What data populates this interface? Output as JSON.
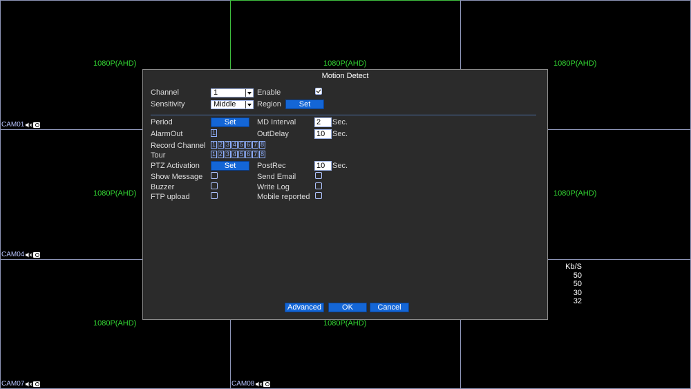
{
  "cameras": [
    {
      "id": "cam1",
      "resolution": "1080P(AHD)",
      "label": "CAM01"
    },
    {
      "id": "cam2",
      "resolution": "1080P(AHD)",
      "label": ""
    },
    {
      "id": "cam3",
      "resolution": "1080P(AHD)",
      "label": ""
    },
    {
      "id": "cam4",
      "resolution": "1080P(AHD)",
      "label": "CAM04"
    },
    {
      "id": "cam5",
      "resolution": "",
      "label": ""
    },
    {
      "id": "cam6",
      "resolution": "1080P(AHD)",
      "label": ""
    },
    {
      "id": "cam7",
      "resolution": "1080P(AHD)",
      "label": "CAM07"
    },
    {
      "id": "cam8",
      "resolution": "1080P(AHD)",
      "label": "CAM08"
    },
    {
      "id": "cam9",
      "resolution": "",
      "label": ""
    }
  ],
  "bitrate": {
    "header": "Kb/S",
    "values": [
      "50",
      "50",
      "30",
      "32"
    ]
  },
  "dialog": {
    "title": "Motion Detect",
    "channel_label": "Channel",
    "channel_value": "1",
    "enable_label": "Enable",
    "sensitivity_label": "Sensitivity",
    "sensitivity_value": "Middle",
    "region_label": "Region",
    "set_label": "Set",
    "period_label": "Period",
    "md_interval_label": "MD Interval",
    "md_interval_value": "2",
    "sec_label": "Sec.",
    "alarmout_label": "AlarmOut",
    "alarmout_value": "1",
    "outdelay_label": "OutDelay",
    "outdelay_value": "10",
    "record_channel_label": "Record Channel",
    "tour_label": "Tour",
    "channels": [
      "1",
      "2",
      "3",
      "4",
      "5",
      "6",
      "7",
      "8"
    ],
    "ptz_label": "PTZ Activation",
    "postrec_label": "PostRec",
    "postrec_value": "10",
    "show_message_label": "Show Message",
    "send_email_label": "Send Email",
    "buzzer_label": "Buzzer",
    "write_log_label": "Write Log",
    "ftp_label": "FTP upload",
    "mobile_label": "Mobile reported",
    "advanced_label": "Advanced",
    "ok_label": "OK",
    "cancel_label": "Cancel"
  }
}
